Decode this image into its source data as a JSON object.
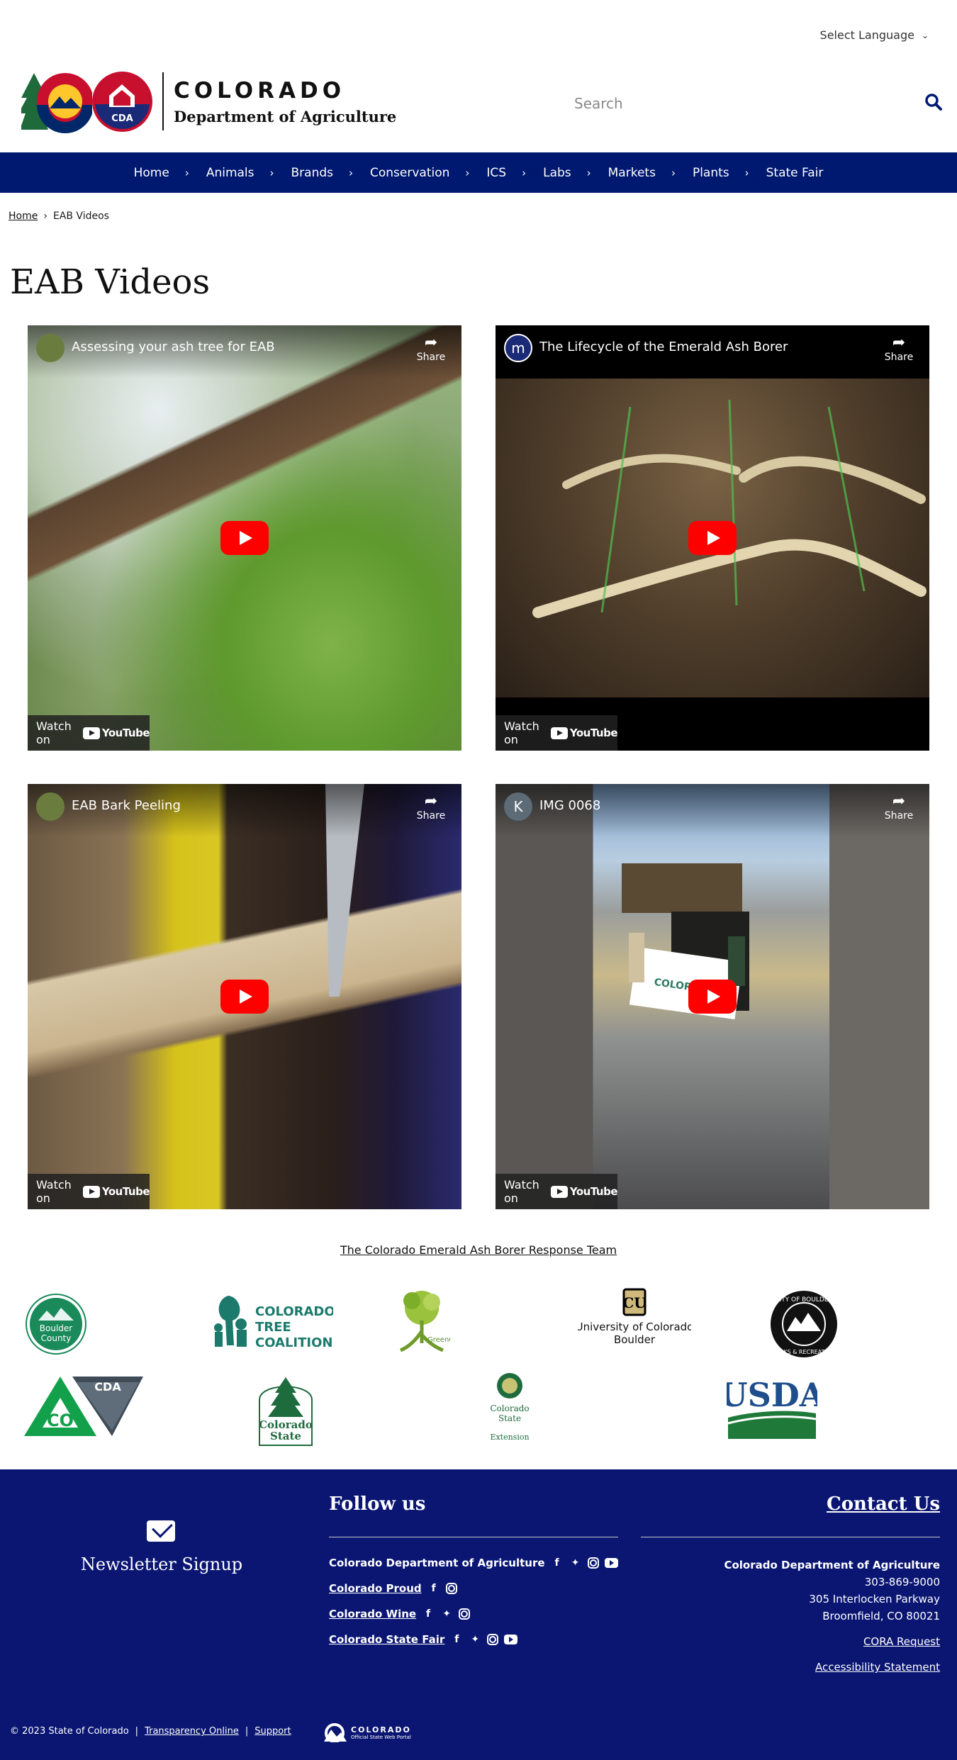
{
  "header": {
    "language_label": "Select Language",
    "logo_line1": "COLORADO",
    "logo_line2": "Department of Agriculture",
    "cda_badge": "CDA",
    "search_placeholder": "Search"
  },
  "nav": {
    "items": [
      "Home",
      "Animals",
      "Brands",
      "Conservation",
      "ICS",
      "Labs",
      "Markets",
      "Plants",
      "State Fair"
    ]
  },
  "breadcrumb": {
    "home": "Home",
    "current": "EAB Videos"
  },
  "page": {
    "title": "EAB Videos"
  },
  "videos": [
    {
      "title": "Assessing your ash tree for EAB",
      "channel_initial": "",
      "share": "Share",
      "watch_on": "Watch on",
      "yt": "YouTube"
    },
    {
      "title": "The Lifecycle of the Emerald Ash Borer",
      "channel_initial": "m",
      "share": "Share",
      "watch_on": "Watch on",
      "yt": "YouTube"
    },
    {
      "title": "EAB Bark Peeling",
      "channel_initial": "",
      "share": "Share",
      "watch_on": "Watch on",
      "yt": "YouTube"
    },
    {
      "title": "IMG 0068",
      "channel_initial": "K",
      "share": "Share",
      "watch_on": "Watch on",
      "yt": "YouTube"
    }
  ],
  "team_link": "The Colorado Emerald Ash Borer Response Team",
  "partners": {
    "boulder_county": "Boulder County",
    "tree_coalition": [
      "COLORADO",
      "TREE",
      "COALITION"
    ],
    "greenco": "GreenCO",
    "cu_boulder": [
      "University of Colorado",
      "Boulder"
    ],
    "city_boulder": "CITY OF BOULDER",
    "cda": "CDA",
    "co": "CO",
    "csfs": [
      "Colorado",
      "State"
    ],
    "csu": [
      "Colorado",
      "State",
      "Extension"
    ],
    "usda": "USDA"
  },
  "footer": {
    "newsletter": "Newsletter Signup",
    "follow_us": "Follow us",
    "social": [
      {
        "label": "Colorado Department of Agriculture",
        "link": false
      },
      {
        "label": "Colorado Proud",
        "link": true
      },
      {
        "label": "Colorado Wine",
        "link": true
      },
      {
        "label": "Colorado State Fair",
        "link": true
      }
    ],
    "contact_title": "Contact Us",
    "contact_org": "Colorado Department of Agriculture",
    "contact_phone": "303-869-9000",
    "contact_street": "305 Interlocken Parkway",
    "contact_city": "Broomfield, CO 80021",
    "cora": "CORA Request",
    "accessibility": "Accessibility Statement",
    "copyright": "© 2023 State of Colorado",
    "transparency": "Transparency Online",
    "support": "Support",
    "portal_line1": "COLORADO",
    "portal_line2": "Official State Web Portal"
  },
  "colors": {
    "nav_blue": "#001970",
    "footer_blue": "#0a1672",
    "youtube_red": "#ff0000"
  }
}
